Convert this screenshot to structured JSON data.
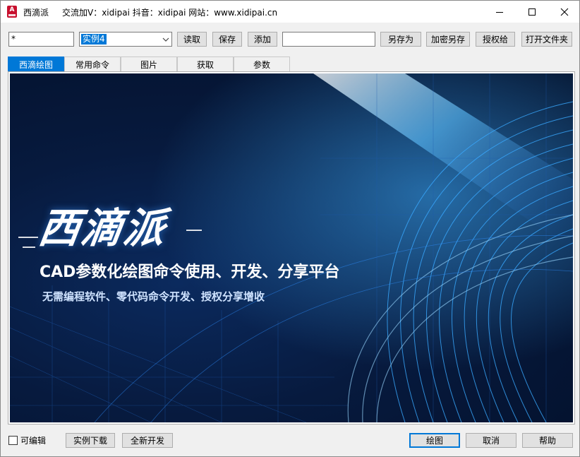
{
  "window": {
    "title": "西滴派",
    "info": "交流加V：xidipai   抖音：xidipai   网站：www.xidipai.cn",
    "app_icon_letter": "A"
  },
  "toolbar": {
    "filter_value": "*",
    "example_selected": "实例4",
    "read_label": "读取",
    "save_label": "保存",
    "add_label": "添加",
    "name_value": "",
    "save_as_label": "另存为",
    "encrypt_save_as_label": "加密另存",
    "authorize_label": "授权给",
    "open_folder_label": "打开文件夹"
  },
  "tabs": [
    {
      "label": "西滴绘图",
      "active": true
    },
    {
      "label": "常用命令",
      "active": false
    },
    {
      "label": "图片",
      "active": false
    },
    {
      "label": "获取",
      "active": false
    },
    {
      "label": "参数",
      "active": false
    }
  ],
  "banner": {
    "brand": "西滴派",
    "tagline": "CAD参数化绘图命令使用、开发、分享平台",
    "subline": "无需编程软件、零代码命令开发、授权分享增收"
  },
  "footer": {
    "editable_label": "可编辑",
    "editable_checked": false,
    "download_examples_label": "实例下载",
    "new_dev_label": "全新开发",
    "draw_label": "绘图",
    "cancel_label": "取消",
    "help_label": "帮助"
  },
  "colors": {
    "accent": "#0078d7",
    "banner_bg": "#071a3e",
    "banner_glow": "#2fa8ff"
  }
}
